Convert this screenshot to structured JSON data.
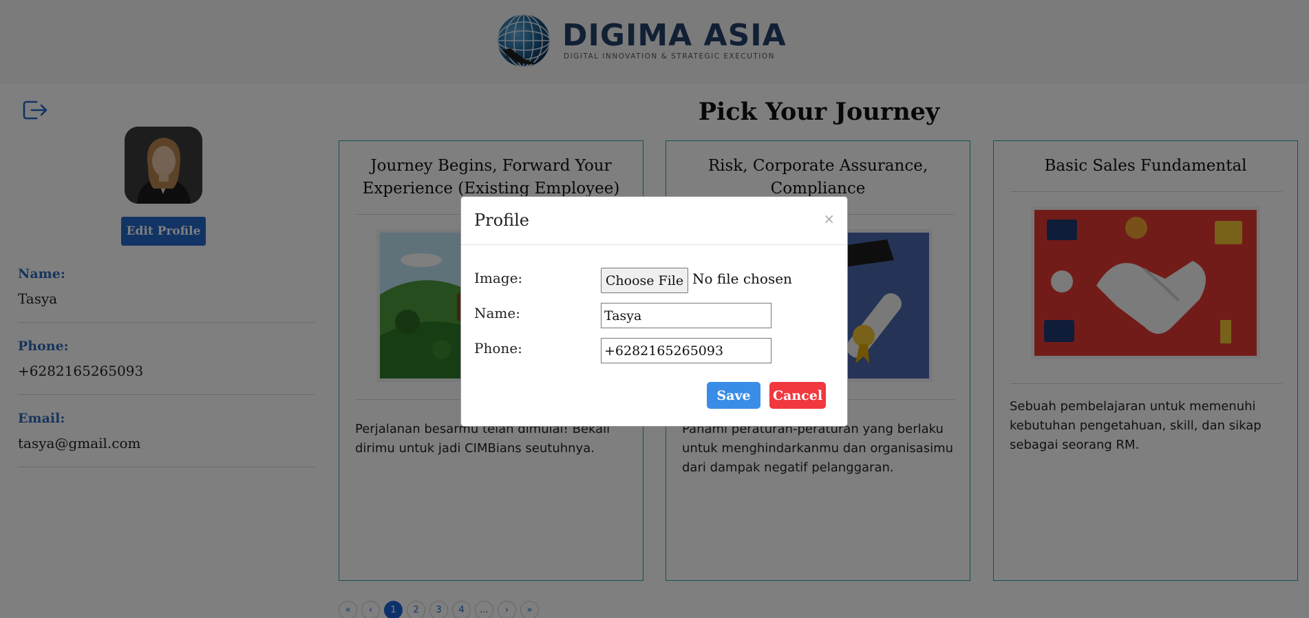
{
  "header": {
    "logo_title": "DIGIMA ASIA",
    "logo_subtitle": "DIGITAL INNOVATION & STRATEGIC EXECUTION"
  },
  "sidebar": {
    "logout_icon": "logout-icon",
    "edit_profile_label": "Edit Profile",
    "fields": [
      {
        "label": "Name:",
        "value": "Tasya"
      },
      {
        "label": "Phone:",
        "value": "+6282165265093"
      },
      {
        "label": "Email:",
        "value": "tasya@gmail.com"
      }
    ]
  },
  "main": {
    "title": "Pick Your Journey",
    "cards": [
      {
        "title": "Journey Begins, Forward Your Experience (Existing Employee)",
        "description": "Perjalanan besarmu telah dimulai! Bekali dirimu untuk jadi CIMBians seutuhnya."
      },
      {
        "title": "Risk, Corporate Assurance, Compliance",
        "description": "Pahami peraturan-peraturan yang berlaku untuk menghindarkanmu dan organisasimu dari dampak negatif pelanggaran."
      },
      {
        "title": "Basic Sales Fundamental",
        "description": "Sebuah pembelajaran untuk memenuhi kebutuhan pengetahuan, skill, dan sikap sebagai seorang RM."
      }
    ],
    "pagination": [
      "«",
      "‹",
      "1",
      "2",
      "3",
      "4",
      "...",
      "›",
      "»"
    ],
    "active_page": "1"
  },
  "modal": {
    "title": "Profile",
    "close": "×",
    "image_label": "Image:",
    "choose_file_label": "Choose File",
    "no_file_text": "No file chosen",
    "name_label": "Name:",
    "name_value": "Tasya",
    "phone_label": "Phone:",
    "phone_value": "+6282165265093",
    "save_label": "Save",
    "cancel_label": "Cancel"
  },
  "colors": {
    "primary": "#2268c9",
    "label_blue": "#2e6bb8",
    "card_border": "#22a5a5",
    "save": "#3a8de6",
    "cancel": "#f1383f"
  }
}
